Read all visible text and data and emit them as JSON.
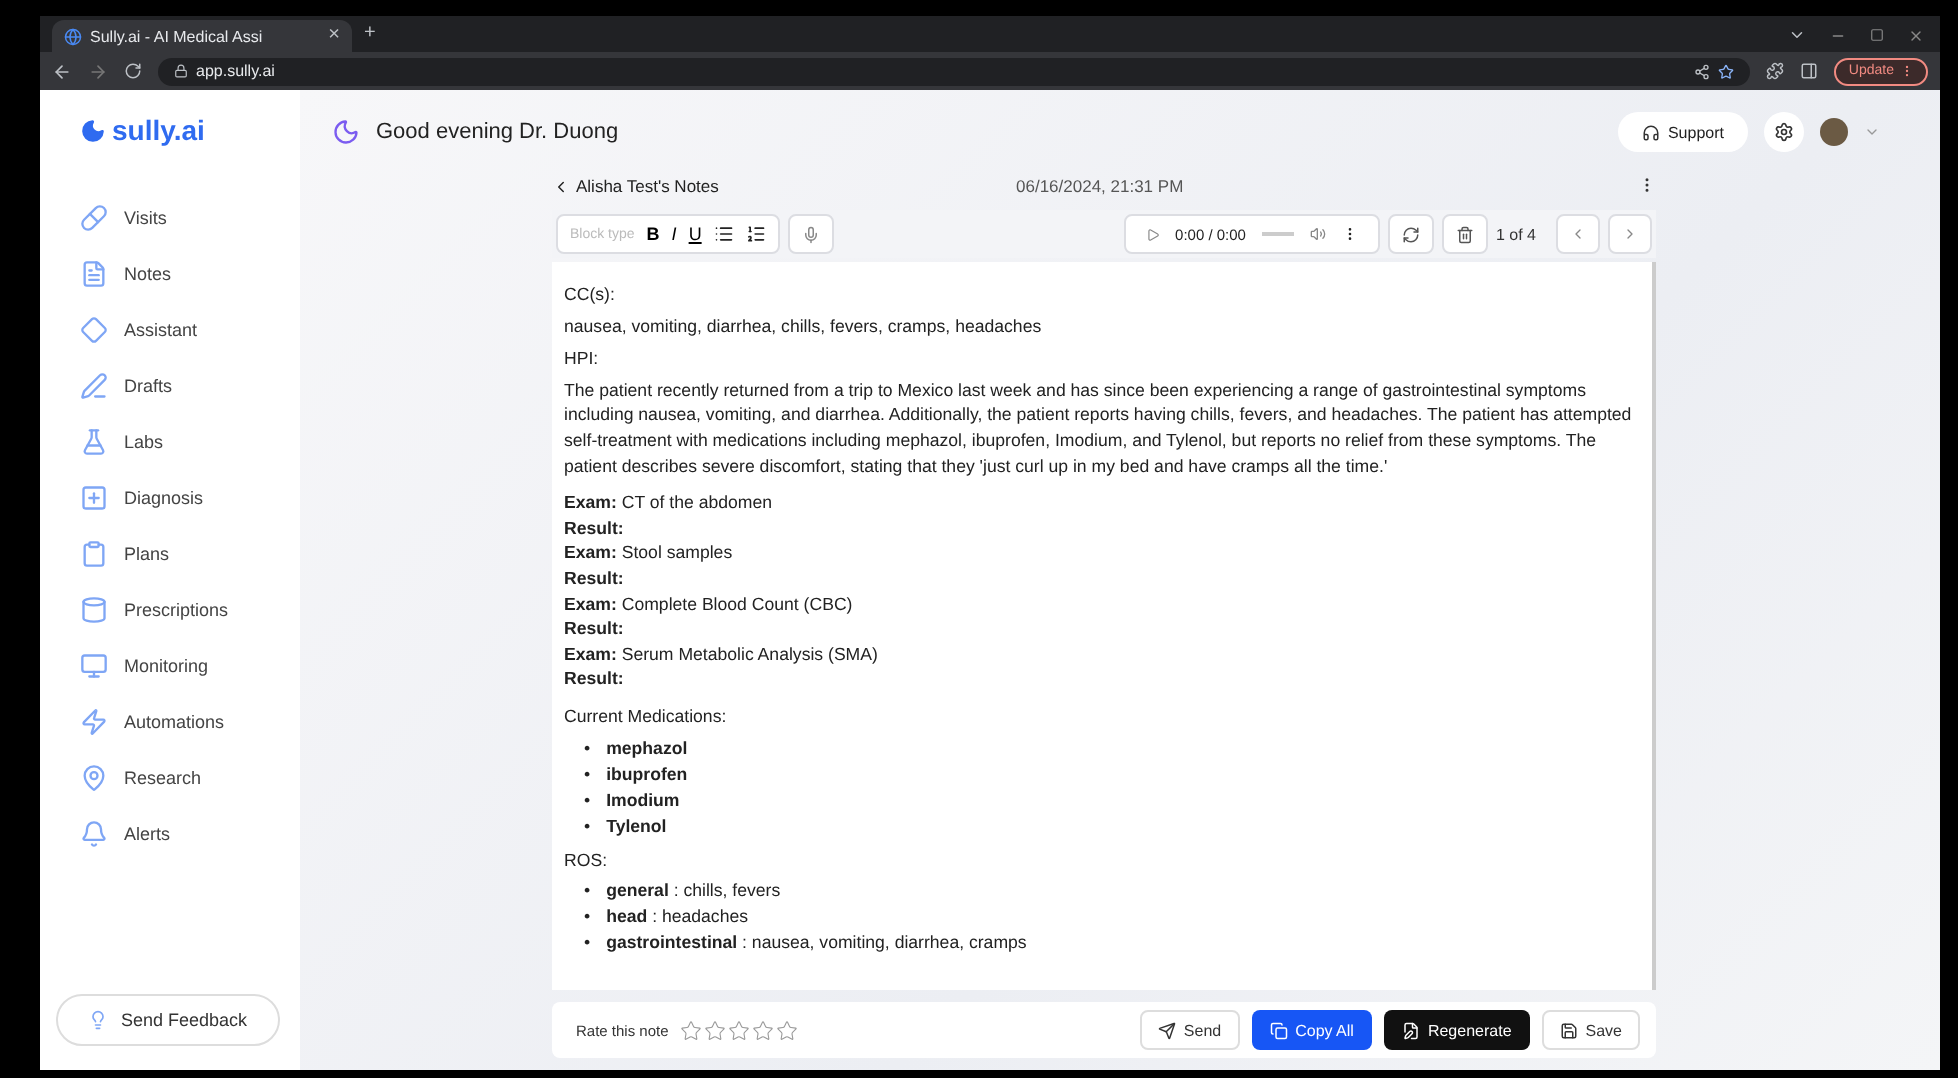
{
  "browser": {
    "tab_title": "Sully.ai - AI Medical Assi",
    "tab_close": "×",
    "new_tab": "+",
    "url": "app.sully.ai",
    "update_button": "Update"
  },
  "sidebar": {
    "logo": "sully.ai",
    "items": [
      {
        "label": "Visits"
      },
      {
        "label": "Notes"
      },
      {
        "label": "Assistant"
      },
      {
        "label": "Drafts"
      },
      {
        "label": "Labs"
      },
      {
        "label": "Diagnosis"
      },
      {
        "label": "Plans"
      },
      {
        "label": "Prescriptions"
      },
      {
        "label": "Monitoring"
      },
      {
        "label": "Automations"
      },
      {
        "label": "Research"
      },
      {
        "label": "Alerts"
      }
    ],
    "feedback_button": "Send Feedback"
  },
  "header": {
    "greeting": "Good evening Dr. Duong",
    "support_button": "Support"
  },
  "note": {
    "back_link": "Alisha Test's Notes",
    "timestamp": "06/16/2024, 21:31 PM",
    "toolbar": {
      "block_type_placeholder": "Block type",
      "format_buttons": [
        "B",
        "I",
        "U"
      ],
      "player_time": "0:00 / 0:00",
      "page_indicator": "1 of 4"
    },
    "sections": [
      {
        "kind": "text",
        "heading": "CC(s):",
        "body": "nausea, vomiting, diarrhea, chills, fevers, cramps, headaches"
      },
      {
        "kind": "text",
        "heading": "HPI:",
        "body": "The patient recently returned from a trip to Mexico last week and has since been experiencing a range of gastrointestinal symptoms including nausea, vomiting, and diarrhea. Additionally, the patient reports having chills, fevers, and headaches. The patient has attempted self-treatment with medications including mephazol, ibuprofen, Imodium, and Tylenol, but reports no relief from these symptoms. The patient describes severe discomfort, stating that they 'just curl up in my bed and have cramps all the time.'"
      },
      {
        "kind": "lines",
        "lines": [
          "**Exam:** CT of the abdomen",
          "**Result:**",
          "**Exam:** Stool samples",
          "**Result:**",
          "**Exam:** Complete Blood Count (CBC)",
          "**Result:**",
          "**Exam:** Serum Metabolic Analysis (SMA)",
          "**Result:**"
        ]
      },
      {
        "kind": "bold-bullets",
        "heading": "Current Medications:",
        "marker": "•",
        "items": [
          "mephazol",
          "ibuprofen",
          "Imodium",
          "Tylenol"
        ]
      },
      {
        "kind": "bullets",
        "heading": "ROS:",
        "marker": "•",
        "items": [
          "**general** : chills, fevers",
          "**head** : headaches",
          "**gastrointestinal** : nausea, vomiting, diarrhea, cramps"
        ]
      }
    ],
    "rating": {
      "label": "Rate this note",
      "stars": 0
    },
    "actions": [
      {
        "label": "Send",
        "kind": "outline"
      },
      {
        "label": "Copy All",
        "kind": "primary"
      },
      {
        "label": "Regenerate",
        "kind": "dark"
      },
      {
        "label": "Save",
        "kind": "outline"
      }
    ]
  }
}
